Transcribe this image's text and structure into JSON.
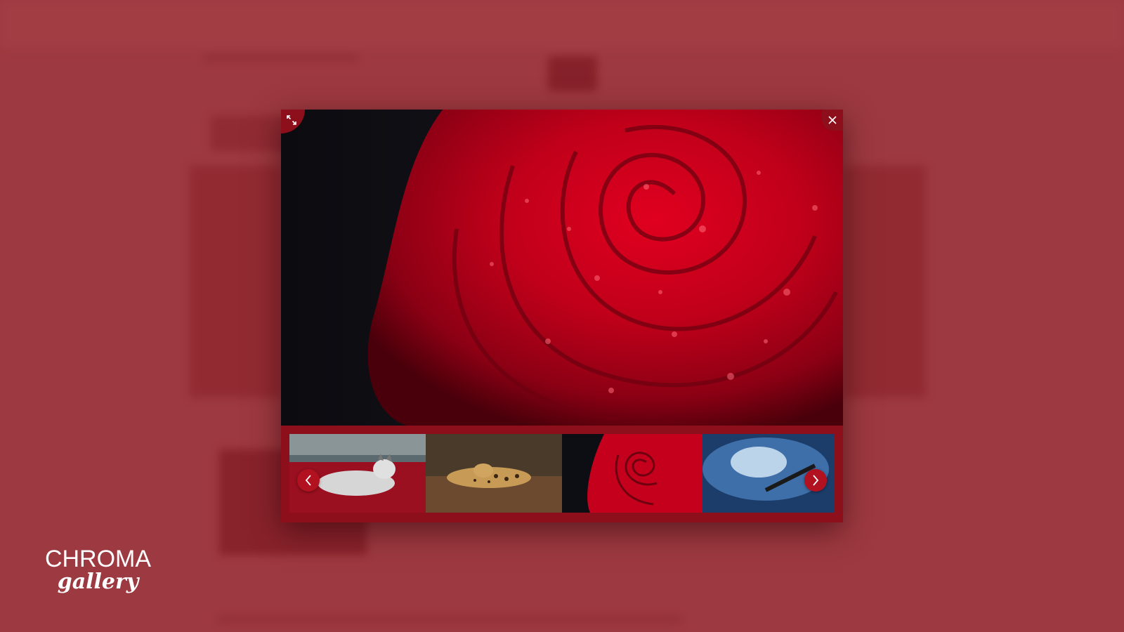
{
  "app": {
    "logo_primary": "CHROMA",
    "logo_secondary": "gallery"
  },
  "lightbox": {
    "current_image": "red-rose",
    "expand_icon": "expand-icon",
    "close_icon": "close-icon",
    "prev_icon": "chevron-left-icon",
    "next_icon": "chevron-right-icon",
    "thumbnails": [
      {
        "subject": "wolf"
      },
      {
        "subject": "leopard"
      },
      {
        "subject": "red-rose"
      },
      {
        "subject": "ocean-wave"
      }
    ]
  },
  "colors": {
    "accent": "#b2111f",
    "frame": "#8d0f1b",
    "backdrop": "#9c3f44"
  }
}
